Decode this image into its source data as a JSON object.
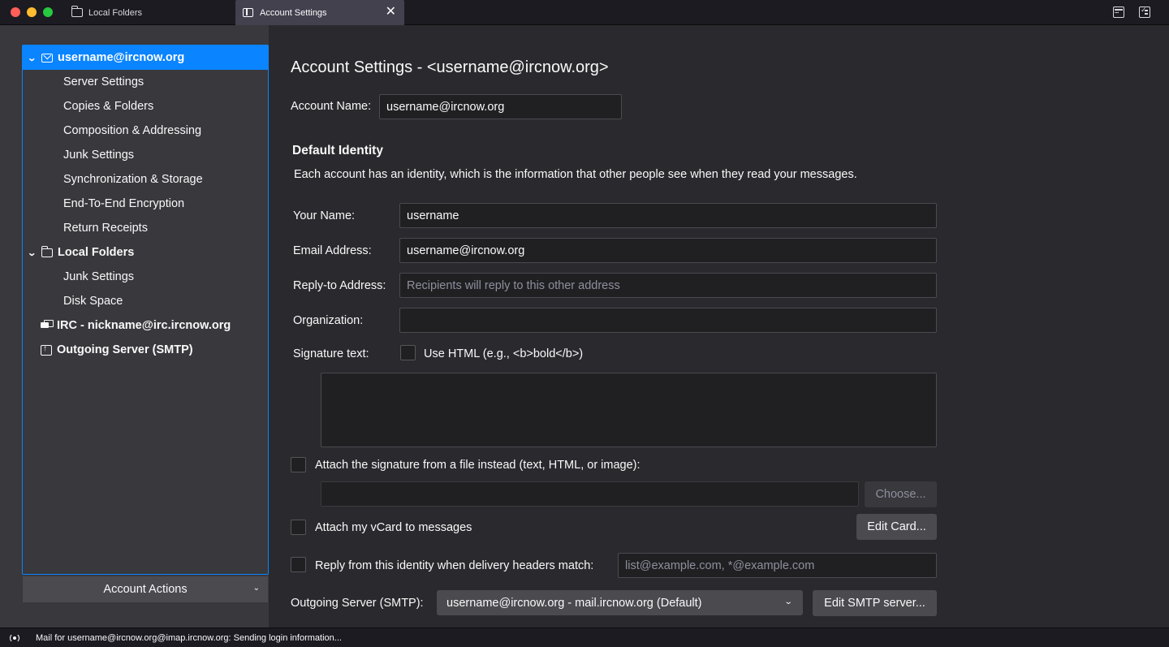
{
  "tabs": [
    {
      "label": "Local Folders",
      "icon": "folder-icon"
    },
    {
      "label": "Account Settings",
      "icon": "settings-icon",
      "close": "✕"
    }
  ],
  "sidebar": {
    "items": [
      {
        "label": "username@ircnow.org",
        "level": 0,
        "icon": "mail-icon",
        "expanded": true,
        "selected": true
      },
      {
        "label": "Server Settings",
        "level": 1
      },
      {
        "label": "Copies & Folders",
        "level": 1
      },
      {
        "label": "Composition & Addressing",
        "level": 1
      },
      {
        "label": "Junk Settings",
        "level": 1
      },
      {
        "label": "Synchronization & Storage",
        "level": 1
      },
      {
        "label": "End-To-End Encryption",
        "level": 1
      },
      {
        "label": "Return Receipts",
        "level": 1
      },
      {
        "label": "Local Folders",
        "level": 0,
        "icon": "folder-icon",
        "expanded": true
      },
      {
        "label": "Junk Settings",
        "level": 1
      },
      {
        "label": "Disk Space",
        "level": 1
      },
      {
        "label": "IRC - nickname@irc.ircnow.org",
        "level": 0,
        "icon": "chat-icon"
      },
      {
        "label": "Outgoing Server (SMTP)",
        "level": 0,
        "icon": "outgoing-server-icon"
      }
    ],
    "account_actions": "Account Actions"
  },
  "main": {
    "title": "Account Settings - <username@ircnow.org>",
    "account_name_label": "Account Name:",
    "account_name_value": "username@ircnow.org",
    "default_identity_heading": "Default Identity",
    "identity_description": "Each account has an identity, which is the information that other people see when they read your messages.",
    "your_name_label": "Your Name:",
    "your_name_value": "username",
    "email_label": "Email Address:",
    "email_value": "username@ircnow.org",
    "reply_to_label": "Reply-to Address:",
    "reply_to_placeholder": "Recipients will reply to this other address",
    "organization_label": "Organization:",
    "organization_value": "",
    "signature_label": "Signature text:",
    "use_html_label": "Use HTML (e.g., <b>bold</b>)",
    "use_html_checked": false,
    "attach_sig_file_label": "Attach the signature from a file instead (text, HTML, or image):",
    "attach_sig_file_checked": false,
    "choose_button": "Choose...",
    "attach_vcard_label": "Attach my vCard to messages",
    "attach_vcard_checked": false,
    "edit_card_button": "Edit Card...",
    "reply_from_label": "Reply from this identity when delivery headers match:",
    "reply_from_checked": false,
    "reply_from_placeholder": "list@example.com, *@example.com",
    "outgoing_server_label": "Outgoing Server (SMTP):",
    "outgoing_server_value": "username@ircnow.org - mail.ircnow.org (Default)",
    "edit_smtp_button": "Edit SMTP server..."
  },
  "status": {
    "text": "Mail for username@ircnow.org@imap.ircnow.org: Sending login information..."
  },
  "colors": {
    "accent": "#0a84ff",
    "background": "#2a2a2e",
    "sidebar": "#38383d"
  }
}
